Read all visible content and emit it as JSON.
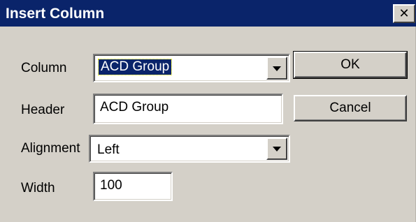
{
  "window": {
    "title": "Insert Column",
    "close_glyph": "✕"
  },
  "form": {
    "column": {
      "label": "Column",
      "value": "ACD Group"
    },
    "header": {
      "label": "Header",
      "value": "ACD Group"
    },
    "alignment": {
      "label": "Alignment",
      "value": "Left"
    },
    "width": {
      "label": "Width",
      "value": "100"
    }
  },
  "buttons": {
    "ok_label": "OK",
    "cancel_label": "Cancel"
  },
  "colors": {
    "titlebar": "#0a246a",
    "dialog_face": "#d4d0c8",
    "selection": "#0a246a"
  },
  "icons": {
    "close": "close-icon",
    "dropdown": "chevron-down-icon"
  }
}
